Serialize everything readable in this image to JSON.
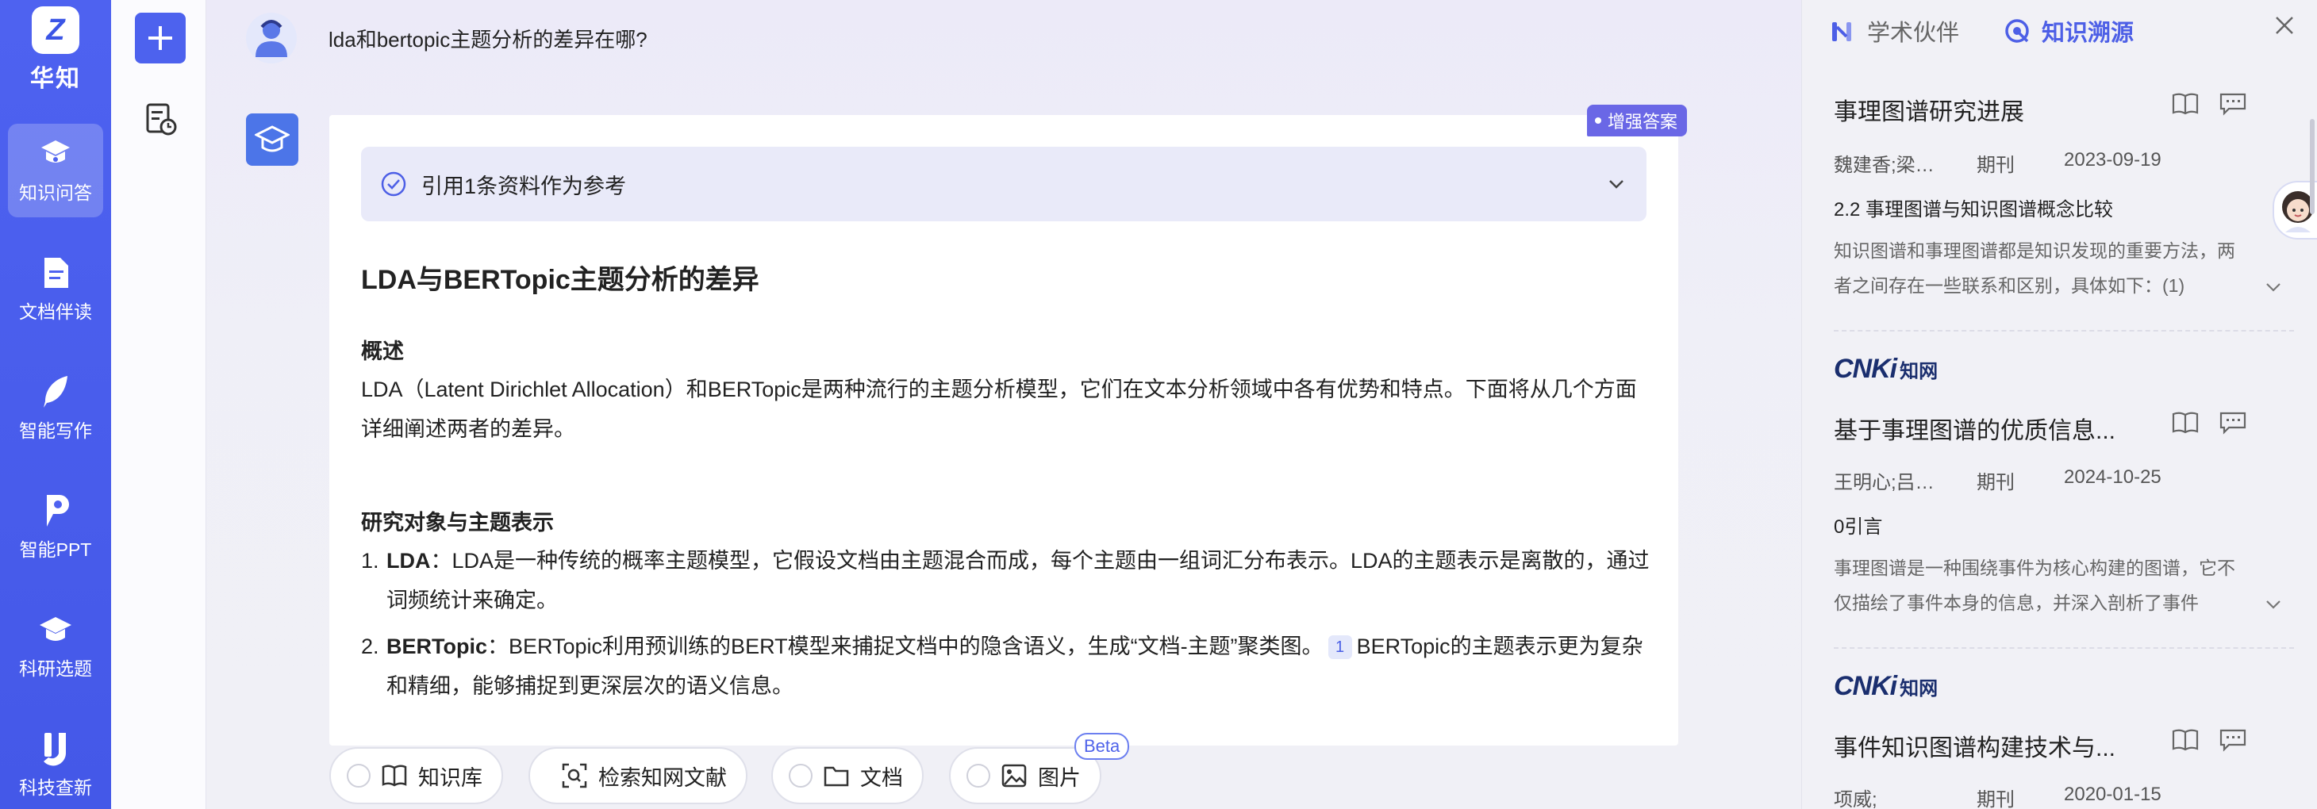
{
  "app": {
    "logo_glyph": "Z",
    "brand": "华知"
  },
  "nav": {
    "items": [
      {
        "label": "知识问答",
        "icon": "chat-hat-icon",
        "active": true
      },
      {
        "label": "文档伴读",
        "icon": "document-icon",
        "active": false
      },
      {
        "label": "智能写作",
        "icon": "feather-pen-icon",
        "active": false
      },
      {
        "label": "智能PPT",
        "icon": "ppt-icon",
        "active": false
      },
      {
        "label": "科研选题",
        "icon": "graduation-cap-icon",
        "active": false
      },
      {
        "label": "科技查新",
        "icon": "search-new-icon",
        "active": false
      }
    ]
  },
  "tools": {
    "new_icon": "plus-icon",
    "history_icon": "history-list-icon"
  },
  "chat": {
    "question": "lda和bertopic主题分析的差异在哪?",
    "badge": "增强答案",
    "reference": {
      "label": "引用1条资料作为参考"
    },
    "answer": {
      "title": "LDA与BERTopic主题分析的差异",
      "section1_heading": "概述",
      "section1_text": "LDA（Latent Dirichlet Allocation）和BERTopic是两种流行的主题分析模型，它们在文本分析领域中各有优势和特点。下面将从几个方面详细阐述两者的差异。",
      "section2_heading": "研究对象与主题表示",
      "list": [
        {
          "num": "1.",
          "term": "LDA",
          "text": "：LDA是一种传统的概率主题模型，它假设文档由主题混合而成，每个主题由一组词汇分布表示。LDA的主题表示是离散的，通过词频统计来确定。",
          "cite": ""
        },
        {
          "num": "2.",
          "term": "BERTopic",
          "text": "：BERTopic利用预训练的BERT模型来捕捉文档中的隐含语义，生成“文档-主题”聚类图。",
          "cite": "1",
          "text_after": "BERTopic的主题表示更为复杂和精细，能够捕捉到更深层次的语义信息。"
        }
      ]
    }
  },
  "chips": [
    {
      "label": "知识库",
      "icon": "book-icon"
    },
    {
      "label": "检索知网文献",
      "icon": "scan-search-icon"
    },
    {
      "label": "文档",
      "icon": "folder-icon"
    },
    {
      "label": "图片",
      "icon": "image-icon"
    }
  ],
  "beta": "Beta",
  "right_panel": {
    "tabs": [
      {
        "label": "学术伙伴",
        "active": false
      },
      {
        "label": "知识溯源",
        "active": true
      }
    ],
    "cnki_mark": "CNKi",
    "cnki_name": "知网",
    "cards": [
      {
        "title": "事理图谱研究进展",
        "authors": "魏建香;梁帅;朱...",
        "type": "期刊",
        "date": "2023-09-19",
        "subtitle": "2.2 事理图谱与知识图谱概念比较",
        "snippet": "知识图谱和事理图谱都是知识发现的重要方法，两者之间存在一些联系和区别，具体如下：(1)"
      },
      {
        "title": "基于事理图谱的优质信息...",
        "authors": "王明心;吕赛鸽;...",
        "type": "期刊",
        "date": "2024-10-25",
        "subtitle": "0引言",
        "snippet": "事理图谱是一种围绕事件为核心构建的图谱，它不仅描绘了事件本身的信息，并深入剖析了事件"
      },
      {
        "title": "事件知识图谱构建技术与...",
        "authors": "项威;",
        "type": "期刊",
        "date": "2020-01-15",
        "subtitle": "",
        "snippet": ""
      }
    ]
  },
  "colors": {
    "nav_bg": "#4e62f0",
    "accent": "#4d5fe6",
    "badge": "#6a67e6",
    "reference_bg": "#e9eaf9"
  }
}
